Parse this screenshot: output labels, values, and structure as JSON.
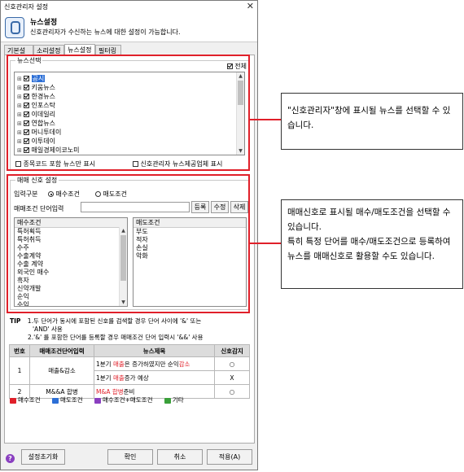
{
  "window": {
    "title": "신호관리자 설정",
    "close_glyph": "✕"
  },
  "header": {
    "title": "뉴스설정",
    "subtitle": "신호관리자가 수신하는 뉴스에 대한 설정이 가능합니다."
  },
  "tabs": [
    "기본설정",
    "소리설정",
    "뉴스설정",
    "필터링"
  ],
  "news_select": {
    "legend": "뉴스선택",
    "all_label": "전체",
    "items": [
      "공시",
      "키움뉴스",
      "한경뉴스",
      "인포스탁",
      "이데일리",
      "연합뉴스",
      "머니투데이",
      "이투데이",
      "매일경제이코노미"
    ],
    "option_code_only": "종목코드 포함 뉴스만 표시",
    "option_provider": "신호관리자 뉴스제공업체 표시"
  },
  "trade_signal": {
    "legend": "매매 신호 설정",
    "input_type_label": "입력구분",
    "buy_label": "매수조건",
    "sell_label": "매도조건",
    "word_input_label": "매매조건 단어입력",
    "word_input_value": "",
    "register_button": "등록",
    "edit_button": "수정",
    "delete_button": "삭제",
    "buy_list_header": "매수조건",
    "buy_list": [
      "특허획득",
      "특허취득",
      "수주",
      "수출계약",
      "수출 계약",
      "외국인 매수",
      "흑자",
      "신약개발",
      "순익",
      "수익"
    ],
    "sell_list_header": "매도조건",
    "sell_list": [
      "부도",
      "적자",
      "손실",
      "악화"
    ]
  },
  "tip": {
    "label": "TIP",
    "line1": "1.두 단어가 동시에 포함된 신호를 검색할 경우 단어 사이에 '&' 또는",
    "line1b": "'AND' 사용",
    "line2": "2.'&' 를 포함한 단어를 등록할 경우 매매조건 단어 입력시 '&&' 사용"
  },
  "example_table": {
    "headers": [
      "번호",
      "매매조건단어입력",
      "뉴스제목",
      "신호감지"
    ],
    "rows": [
      {
        "no": "1",
        "word": "매출&감소",
        "title_pre": "1분기 ",
        "title_red1": "매출",
        "title_mid": "은 증가하였지만 순익",
        "title_red2": "감소",
        "title_post": "",
        "detect": "○"
      },
      {
        "no": "",
        "word": "",
        "title_pre": "1분기 ",
        "title_red1": "매출",
        "title_mid": "증가 예상",
        "title_red2": "",
        "title_post": "",
        "detect": "X"
      },
      {
        "no": "2",
        "word": "M&&A 합병",
        "title_pre": "",
        "title_red1": "M&A 합병",
        "title_mid": "준비",
        "title_red2": "",
        "title_post": "",
        "detect": "○"
      }
    ]
  },
  "legend_bar": {
    "items": [
      {
        "label": "매수조건",
        "color": "#e0202a"
      },
      {
        "label": "매도조건",
        "color": "#2d6fd6"
      },
      {
        "label": "매수조건+매도조건",
        "color": "#8a3fc0"
      },
      {
        "label": "기타",
        "color": "#3aa03a"
      }
    ]
  },
  "footer": {
    "help_glyph": "?",
    "reset_button": "설정초기화",
    "ok_button": "확인",
    "cancel_button": "취소",
    "apply_button": "적용(A)"
  },
  "annotations": {
    "top": "\"신호관리자\"창에 표시될 뉴스를 선택할 수 있습니다.",
    "bottom": "매매신호로 표시될 매수/매도조건을 선택할 수 있습니다.\n특히 특정 단어를 매수/매도조건으로 등록하여 뉴스를 매매신호로 활용할 수도 있습니다."
  },
  "colors": {
    "highlight_red": "#e0202a",
    "selection_blue": "#2d6fd6"
  }
}
